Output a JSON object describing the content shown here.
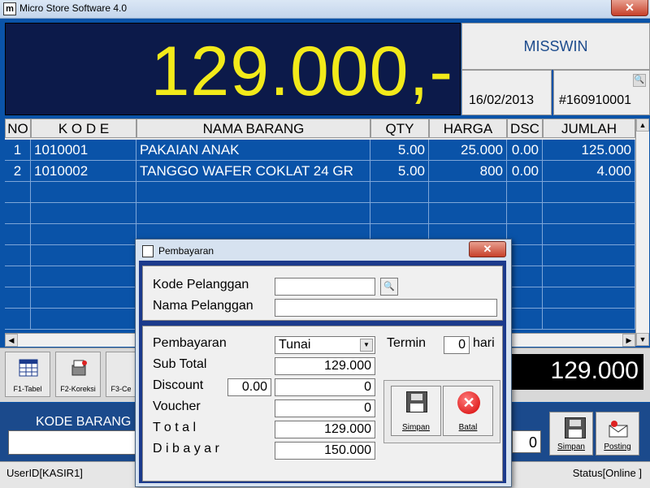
{
  "window": {
    "title": "Micro Store Software 4.0",
    "close_glyph": "✕",
    "icon_glyph": "m"
  },
  "display": {
    "total": "129.000,-",
    "store_name": "MISSWIN",
    "date": "16/02/2013",
    "invoice": "#160910001",
    "zoom_icon": "🔍"
  },
  "grid": {
    "headers": [
      "NO",
      "K O D E",
      "NAMA BARANG",
      "QTY",
      "HARGA",
      "DSC",
      "JUMLAH"
    ],
    "rows": [
      {
        "no": "1",
        "kode": "1010001",
        "nama": "PAKAIAN ANAK",
        "qty": "5.00",
        "harga": "25.000",
        "dsc": "0.00",
        "jumlah": "125.000"
      },
      {
        "no": "2",
        "kode": "1010002",
        "nama": "TANGGO WAFER COKLAT 24 GR",
        "qty": "5.00",
        "harga": "800",
        "dsc": "0.00",
        "jumlah": "4.000"
      }
    ]
  },
  "toolbar": {
    "f1": "F1-Tabel",
    "f2": "F2-Koreksi",
    "f3": "F3-Ce",
    "sum": "129.000"
  },
  "bottom": {
    "kode_label": "KODE BARANG",
    "qty_value": "0",
    "simpan": "Simpan",
    "posting": "Posting"
  },
  "status": {
    "user": "UserID[KASIR1]",
    "status": "Status[Online ]"
  },
  "dialog": {
    "title": "Pembayaran",
    "close_glyph": "✕",
    "kode_pelanggan_label": "Kode Pelanggan",
    "nama_pelanggan_label": "Nama Pelanggan",
    "kode_pelanggan_value": "",
    "nama_pelanggan_value": "",
    "pembayaran_label": "Pembayaran",
    "pembayaran_value": "Tunai",
    "termin_label": "Termin",
    "termin_value": "0",
    "hari_label": "hari",
    "subtotal_label": "Sub Total",
    "subtotal_value": "129.000",
    "discount_label": "Discount",
    "discount_pct": "0.00",
    "discount_value": "0",
    "voucher_label": "Voucher",
    "voucher_value": "0",
    "total_label": "T o t a l",
    "total_value": "129.000",
    "dibayar_label": "D i b a y a r",
    "dibayar_value": "150.000",
    "simpan": "Simpan",
    "batal": "Batal",
    "batal_glyph": "✕",
    "search_glyph": "🔍",
    "dropdown_glyph": "▼"
  },
  "scroll": {
    "up": "▲",
    "down": "▼",
    "left": "◀",
    "right": "▶"
  }
}
